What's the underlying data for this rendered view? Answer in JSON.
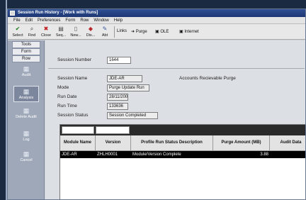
{
  "window": {
    "title": "Session Run History - [Work with Runs]"
  },
  "menu": [
    "File",
    "Edit",
    "Preferences",
    "Form",
    "Row",
    "Window",
    "Help"
  ],
  "toolbar": {
    "buttons": [
      {
        "label": "Select",
        "icon": "checkmark-icon"
      },
      {
        "label": "Find",
        "icon": "find-icon"
      },
      {
        "label": "Close",
        "icon": "close-icon"
      },
      {
        "label": "Seq...",
        "icon": "sequence-icon"
      },
      {
        "label": "New...",
        "icon": "new-icon"
      },
      {
        "label": "Dis...",
        "icon": "display-icon"
      },
      {
        "label": "Abt",
        "icon": "about-icon"
      }
    ],
    "links_label": "Links",
    "purge_label": "Purge",
    "ole_label": "OLE",
    "internet_label": "Internet"
  },
  "left_pane": {
    "tabs": [
      "Tools",
      "Form",
      "Row"
    ],
    "buttons": [
      {
        "label": "Audit",
        "icon": "audit-icon"
      },
      {
        "label": "Analysis",
        "icon": "analysis-icon"
      },
      {
        "label": "Delete Audit",
        "icon": "delete-audit-icon"
      },
      {
        "label": "Log",
        "icon": "log-icon"
      },
      {
        "label": "Cancel",
        "icon": "cancel-icon"
      }
    ]
  },
  "form": {
    "session_number_label": "Session Number",
    "session_number": "1644",
    "session_name_label": "Session Name",
    "session_name": "JDE-AR",
    "session_name_desc": "Accounts Recievable Purge",
    "mode_label": "Mode",
    "mode": "Purge Update Run",
    "run_date_label": "Run Date",
    "run_date": "28/11/200",
    "run_time_label": "Run Time",
    "run_time": "133636",
    "session_status_label": "Session Status",
    "session_status": "Session Completed"
  },
  "grid": {
    "columns": [
      "Module Name",
      "Version",
      "Profile Run Status Description",
      "Purge Amount (MB)",
      "Audit Data"
    ],
    "rows": [
      [
        "JDE-AR",
        "ZHLH0001",
        "Module/Version Complete",
        "3.88",
        ""
      ]
    ]
  },
  "colors": {
    "titlebar": "#2f4f92",
    "desktop": "#1a2a40",
    "grid_band": "#2a2a2a"
  }
}
